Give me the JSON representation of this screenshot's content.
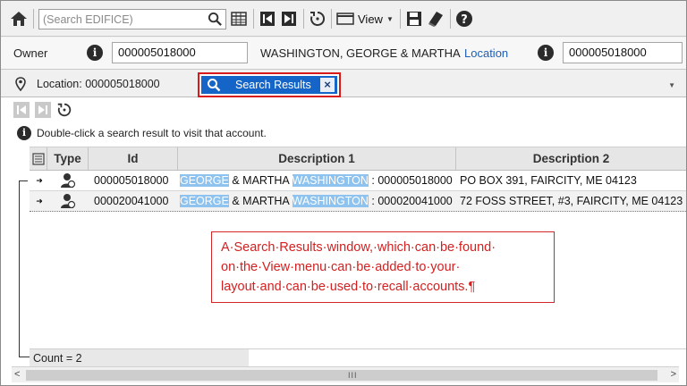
{
  "toolbar": {
    "search_placeholder": "(Search EDIFICE)",
    "view_label": "View"
  },
  "owner": {
    "owner_label": "Owner",
    "owner_id": "000005018000",
    "owner_name": "WASHINGTON, GEORGE & MARTHA",
    "location_link": "Location",
    "location_id": "000005018000"
  },
  "tabs": {
    "location_tab": "Location: 000005018000",
    "search_results_tab": "Search Results"
  },
  "panel": {
    "hint": "Double-click a search result to visit that account."
  },
  "grid": {
    "columns": [
      "Type",
      "Id",
      "Description 1",
      "Description 2"
    ],
    "rows": [
      {
        "id": "000005018000",
        "desc1_a": "GEORGE",
        "desc1_b": " & MARTHA ",
        "desc1_c": "WASHINGTON",
        "desc1_d": " : 000005018000",
        "desc2": "PO BOX 391, FAIRCITY, ME 04123"
      },
      {
        "id": "000020041000",
        "desc1_a": "GEORGE",
        "desc1_b": " & MARTHA ",
        "desc1_c": "WASHINGTON",
        "desc1_d": " : 000020041000",
        "desc2": "72 FOSS STREET, #3, FAIRCITY, ME 04123"
      }
    ],
    "count": "Count = 2"
  },
  "callout": {
    "line1": "A·Search·Results·window,·which·can·be·found·",
    "line2": "on·the·View·menu·can·be·added·to·your·",
    "line3": "layout·and·can·be·used·to·recall·accounts.¶"
  },
  "colors": {
    "accent": "#1565c8",
    "highlight": "#8ec3ef",
    "annotation": "#d42020"
  }
}
